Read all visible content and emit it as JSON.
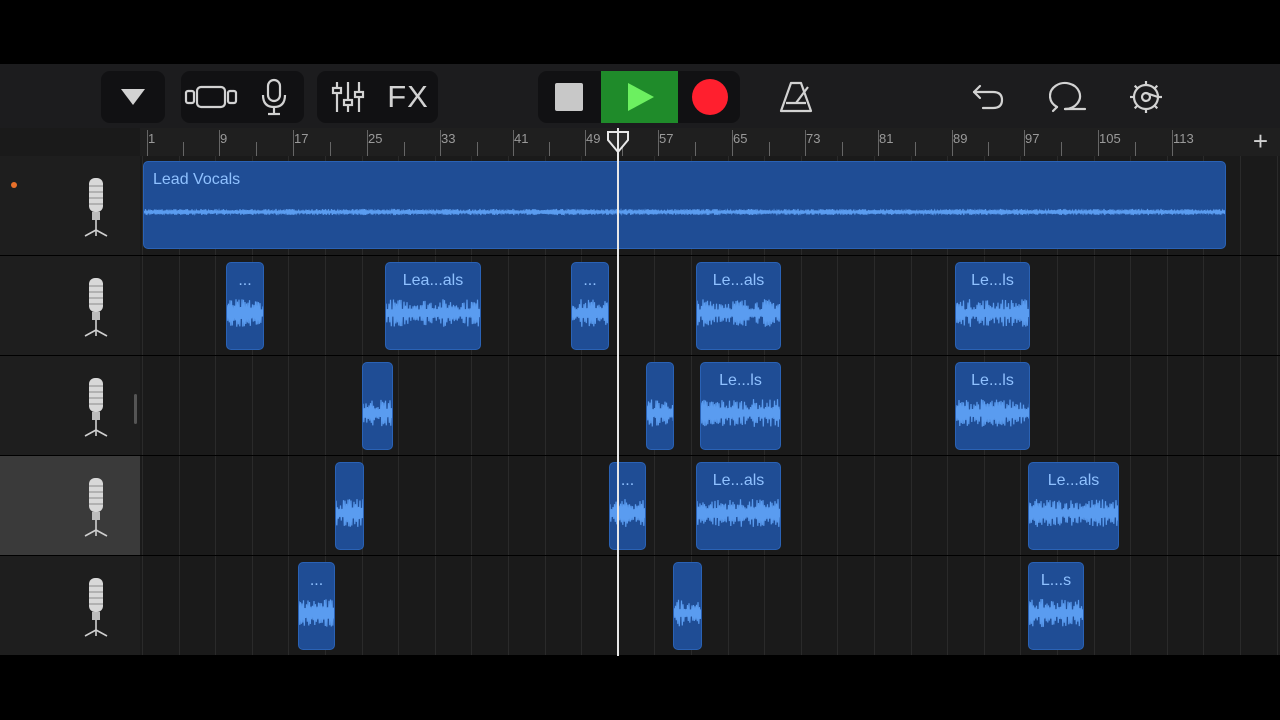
{
  "toolbar": {
    "fx_label": "FX",
    "icons": [
      "dropdown-triangle-icon",
      "tracks-view-icon",
      "microphone-icon",
      "mixer-sliders-icon",
      "stop-icon",
      "play-icon",
      "record-icon",
      "metronome-icon",
      "undo-icon",
      "loop-icon",
      "settings-gear-icon"
    ],
    "colors": {
      "play": "#1f8b2a",
      "record": "#ff1f2e"
    }
  },
  "ruler": {
    "bar_numbers": [
      "1",
      "9",
      "17",
      "25",
      "33",
      "41",
      "49",
      "57",
      "65",
      "73",
      "81",
      "89",
      "97",
      "105",
      "113"
    ],
    "add_label": "+"
  },
  "tracks": [
    {
      "icon": "condenser-microphone-icon",
      "recording_indicator": true,
      "selected": false,
      "regions": [
        {
          "label": "Lead Vocals"
        }
      ]
    },
    {
      "icon": "condenser-microphone-icon",
      "selected": false,
      "regions": [
        {
          "label": "..."
        },
        {
          "label": "Lea...als"
        },
        {
          "label": "..."
        },
        {
          "label": "Le...als"
        },
        {
          "label": "Le...ls"
        }
      ]
    },
    {
      "icon": "condenser-microphone-icon",
      "selected": false,
      "regions": [
        {
          "label": ""
        },
        {
          "label": ""
        },
        {
          "label": "Le...ls"
        },
        {
          "label": "Le...ls"
        }
      ]
    },
    {
      "icon": "condenser-microphone-icon",
      "selected": true,
      "regions": [
        {
          "label": ""
        },
        {
          "label": "..."
        },
        {
          "label": "Le...als"
        },
        {
          "label": "Le...als"
        }
      ]
    },
    {
      "icon": "condenser-microphone-icon",
      "selected": false,
      "regions": [
        {
          "label": "..."
        },
        {
          "label": ""
        },
        {
          "label": "L...s"
        }
      ]
    }
  ],
  "colors": {
    "region_fill": "#1f4d95",
    "region_text": "#8fc1ff",
    "waveform": "#5a9cf0",
    "record_dot": "#e8702a"
  }
}
